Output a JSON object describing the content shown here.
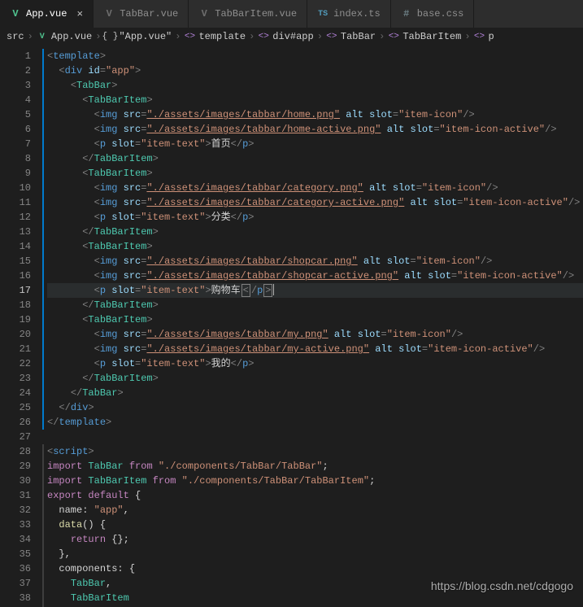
{
  "tabs": [
    {
      "label": "App.vue",
      "icon": "vue",
      "active": true,
      "close": true
    },
    {
      "label": "TabBar.vue",
      "icon": "vue-dim"
    },
    {
      "label": "TabBarItem.vue",
      "icon": "vue-dim"
    },
    {
      "label": "index.ts",
      "icon": "ts"
    },
    {
      "label": "base.css",
      "icon": "hash"
    }
  ],
  "breadcrumbs": [
    {
      "label": "src",
      "icon": ""
    },
    {
      "label": "App.vue",
      "icon": "vue"
    },
    {
      "label": "\"App.vue\"",
      "icon": "brace"
    },
    {
      "label": "template",
      "icon": "tag"
    },
    {
      "label": "div#app",
      "icon": "tag"
    },
    {
      "label": "TabBar",
      "icon": "tag"
    },
    {
      "label": "TabBarItem",
      "icon": "tag"
    },
    {
      "label": "p",
      "icon": "tag"
    }
  ],
  "sep": "›",
  "close_glyph": "×",
  "line_count": 38,
  "current_line": 17,
  "indent": "  ",
  "tpl": {
    "template": "template",
    "div": "div",
    "id": "id",
    "app": "\"app\"",
    "TabBar": "TabBar",
    "TabBarItem": "TabBarItem",
    "img": "img",
    "src": "src",
    "alt": "alt",
    "slot": "slot",
    "p": "p",
    "script": "script",
    "slot_icon": "\"item-icon\"",
    "slot_icon_active": "\"item-icon-active\"",
    "slot_text": "\"item-text\"",
    "home": "\"./assets/images/tabbar/home.png\"",
    "home_active": "\"./assets/images/tabbar/home-active.png\"",
    "home_txt": "首页",
    "cat": "\"./assets/images/tabbar/category.png\"",
    "cat_active": "\"./assets/images/tabbar/category-active.png\"",
    "cat_txt": "分类",
    "shop": "\"./assets/images/tabbar/shopcar.png\"",
    "shop_active": "\"./assets/images/tabbar/shopcar-active.png\"",
    "shop_txt": "购物车",
    "my": "\"./assets/images/tabbar/my.png\"",
    "my_active": "\"./assets/images/tabbar/my-active.png\"",
    "my_txt": "我的"
  },
  "js": {
    "import": "import",
    "from": "from",
    "export": "export",
    "default": "default",
    "TabBar": "TabBar",
    "TabBarItem": "TabBarItem",
    "path_tabbar": "\"./components/TabBar/TabBar\"",
    "path_item": "\"./components/TabBar/TabBarItem\"",
    "name": "name:",
    "app": "\"app\"",
    "data": "data",
    "return": "return",
    "components": "components:",
    "obrace": "{",
    "cbrace": "}",
    "paren": "()",
    "empty": "{}",
    "semi": ";",
    "comma": ","
  },
  "watermark": "https://blog.csdn.net/cdgogo"
}
